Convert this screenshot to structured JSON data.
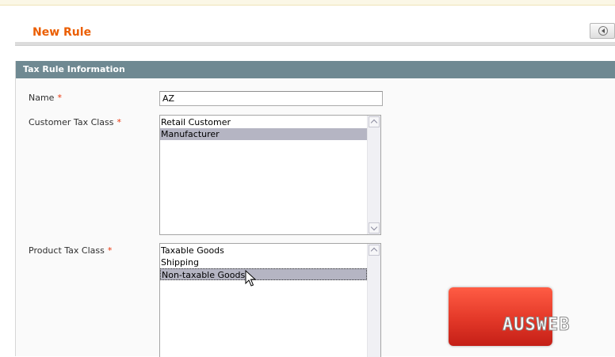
{
  "page": {
    "title": "New Rule"
  },
  "fieldset": {
    "title": "Tax Rule Information"
  },
  "form": {
    "name": {
      "label": "Name",
      "required_mark": "*",
      "value": "AZ"
    },
    "customer_tax_class": {
      "label": "Customer Tax Class",
      "required_mark": "*",
      "options": [
        "Retail Customer",
        "Manufacturer"
      ],
      "selected": [
        "Manufacturer"
      ]
    },
    "product_tax_class": {
      "label": "Product Tax Class",
      "required_mark": "*",
      "options": [
        "Taxable Goods",
        "Shipping",
        "Non-taxable Goods"
      ],
      "selected": [
        "Non-taxable Goods"
      ]
    }
  },
  "watermark": {
    "text": "AUSWEB"
  },
  "icons": {
    "back": "back-arrow-icon",
    "cursor": "mouse-pointer-icon"
  },
  "colors": {
    "title": "#eb5e00",
    "header_bar": "#6f8992",
    "required": "#eb340a",
    "selection": "#b5b5c3"
  }
}
